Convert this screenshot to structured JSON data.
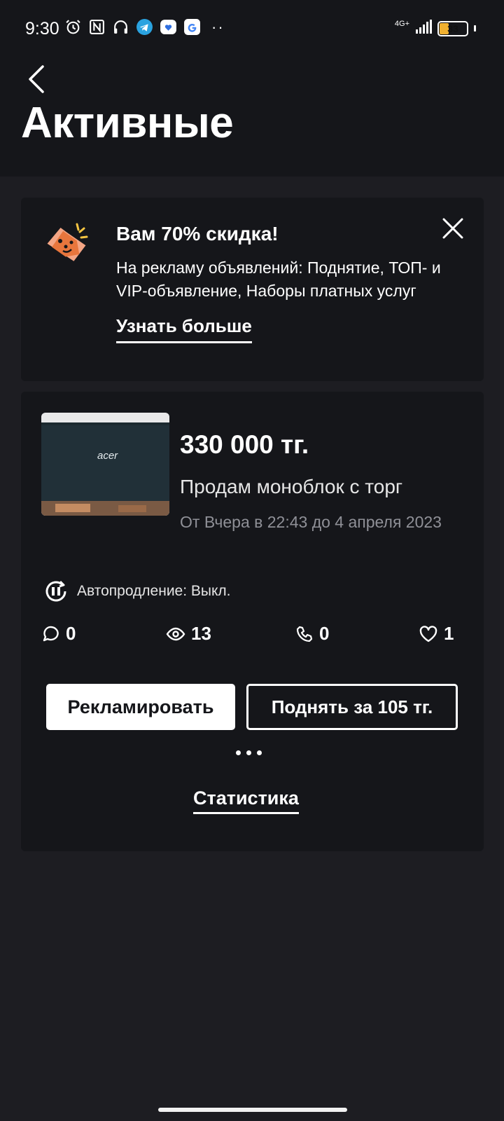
{
  "status_bar": {
    "time": "9:30",
    "icons": [
      "alarm-icon",
      "nfc-icon",
      "headphones-icon",
      "telegram-icon",
      "message-icon",
      "google-icon"
    ],
    "dots": "··",
    "network": "4G+",
    "battery": "33",
    "battery_level": 0.33
  },
  "header": {
    "title": "Активные"
  },
  "promo": {
    "title": "Вам 70% скидка!",
    "text": "На рекламу объявлений: Поднятие, ТОП- и VIP-объявление, Наборы платных услуг",
    "link": "Узнать больше"
  },
  "ad": {
    "price": "330 000 тг.",
    "title": "Продам моноблок  с торг",
    "period": "От Вчера в 22:43 до 4 апреля 2023",
    "thumb_brand": "acer",
    "autorenew": "Автопродление: Выкл.",
    "stats": {
      "messages": "0",
      "views": "13",
      "calls": "0",
      "favorites": "1"
    },
    "promote_button": "Рекламировать",
    "raise_button": "Поднять за 105 тг.",
    "statistics_link": "Статистика"
  },
  "colors": {
    "background": "#1d1d22",
    "card": "#15161a",
    "accent_orange": "#e8763d",
    "text_muted": "#8f9097"
  }
}
